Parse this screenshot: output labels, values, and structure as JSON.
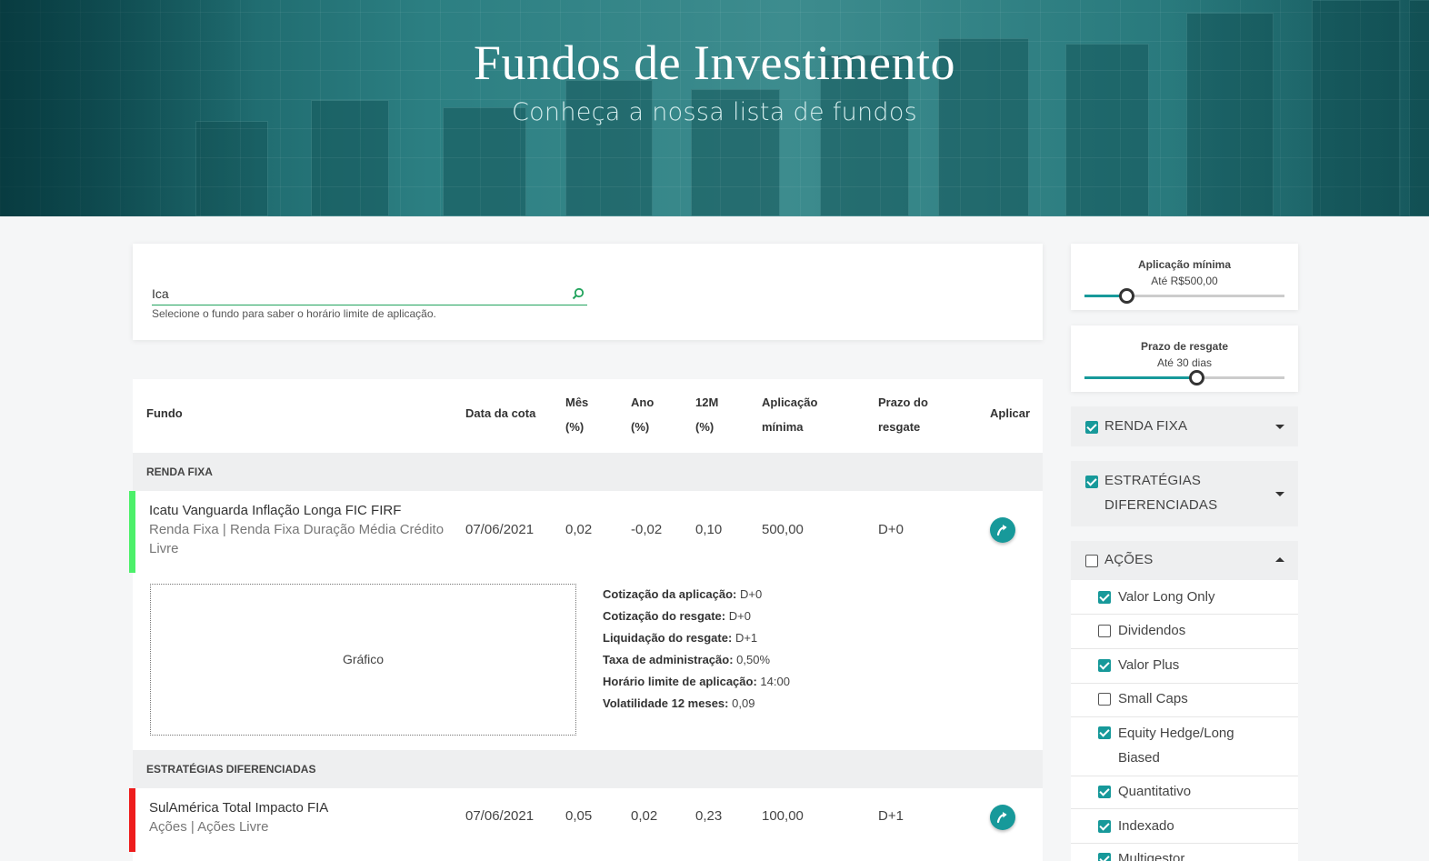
{
  "hero": {
    "title": "Fundos de Investimento",
    "subtitle": "Conheça a nossa lista de fundos"
  },
  "search": {
    "value": "Ica",
    "hint": "Selecione o fundo para saber o horário limite de aplicação."
  },
  "table": {
    "headers": {
      "fundo": "Fundo",
      "data_cota": "Data da cota",
      "mes_1": "Mês",
      "mes_2": "(%)",
      "ano_1": "Ano",
      "ano_2": "(%)",
      "m12_1": "12M",
      "m12_2": "(%)",
      "aplicacao_1": "Aplicação",
      "aplicacao_2": "mínima",
      "prazo_1": "Prazo do",
      "prazo_2": "resgate",
      "aplicar": "Aplicar"
    },
    "categories": [
      {
        "label": "RENDA FIXA",
        "fund": {
          "name": "Icatu Vanguarda Inflação Longa FIC FIRF",
          "category": "Renda Fixa | Renda Fixa Duração Média Crédito Livre",
          "data_cota": "07/06/2021",
          "mes": "0,02",
          "ano": "-0,02",
          "m12": "0,10",
          "aplicacao": "500,00",
          "prazo": "D+0",
          "stripe_color": "#4cf06a"
        }
      },
      {
        "label": "ESTRATÉGIAS DIFERENCIADAS",
        "fund": {
          "name": "SulAmérica Total Impacto FIA",
          "category": "Ações | Ações Livre",
          "data_cota": "07/06/2021",
          "mes": "0,05",
          "ano": "0,02",
          "m12": "0,23",
          "aplicacao": "100,00",
          "prazo": "D+1",
          "stripe_color": "#ee1c1c"
        }
      }
    ],
    "detail": {
      "chart_label": "Gráfico",
      "rows": [
        {
          "label": "Cotização da aplicação:",
          "value": "D+0"
        },
        {
          "label": "Cotização do resgate:",
          "value": "D+0"
        },
        {
          "label": "Liquidação do resgate:",
          "value": "D+1"
        },
        {
          "label": "Taxa de administração:",
          "value": "0,50%"
        },
        {
          "label": "Horário limite de aplicação:",
          "value": "14:00"
        },
        {
          "label": "Volatilidade 12 meses:",
          "value": "0,09"
        }
      ]
    }
  },
  "sidebar": {
    "aplicacao_minima": {
      "title": "Aplicação mínima",
      "value": "Até R$500,00",
      "level": 0.21
    },
    "prazo_resgate": {
      "title": "Prazo de resgate",
      "value": "Até 30 dias",
      "level": 0.56
    },
    "groups": [
      {
        "label": "RENDA FIXA",
        "checked": true,
        "expanded": false
      },
      {
        "label_1": "ESTRATÉGIAS",
        "label_2": "DIFERENCIADAS",
        "checked": true,
        "expanded": false
      },
      {
        "label": "AÇÕES",
        "checked": false,
        "expanded": true
      }
    ],
    "acoes_items": [
      {
        "label": "Valor Long Only",
        "checked": true
      },
      {
        "label": "Dividendos",
        "checked": false
      },
      {
        "label": "Valor Plus",
        "checked": true
      },
      {
        "label": "Small Caps",
        "checked": false
      },
      {
        "label_1": "Equity Hedge/Long",
        "label_2": "Biased",
        "checked": true
      },
      {
        "label": "Quantitativo",
        "checked": true
      },
      {
        "label": "Indexado",
        "checked": true
      },
      {
        "label": "Multigestor",
        "checked": true
      }
    ]
  },
  "colors": {
    "accent": "#17999a",
    "search_underline": "#21a35c"
  }
}
